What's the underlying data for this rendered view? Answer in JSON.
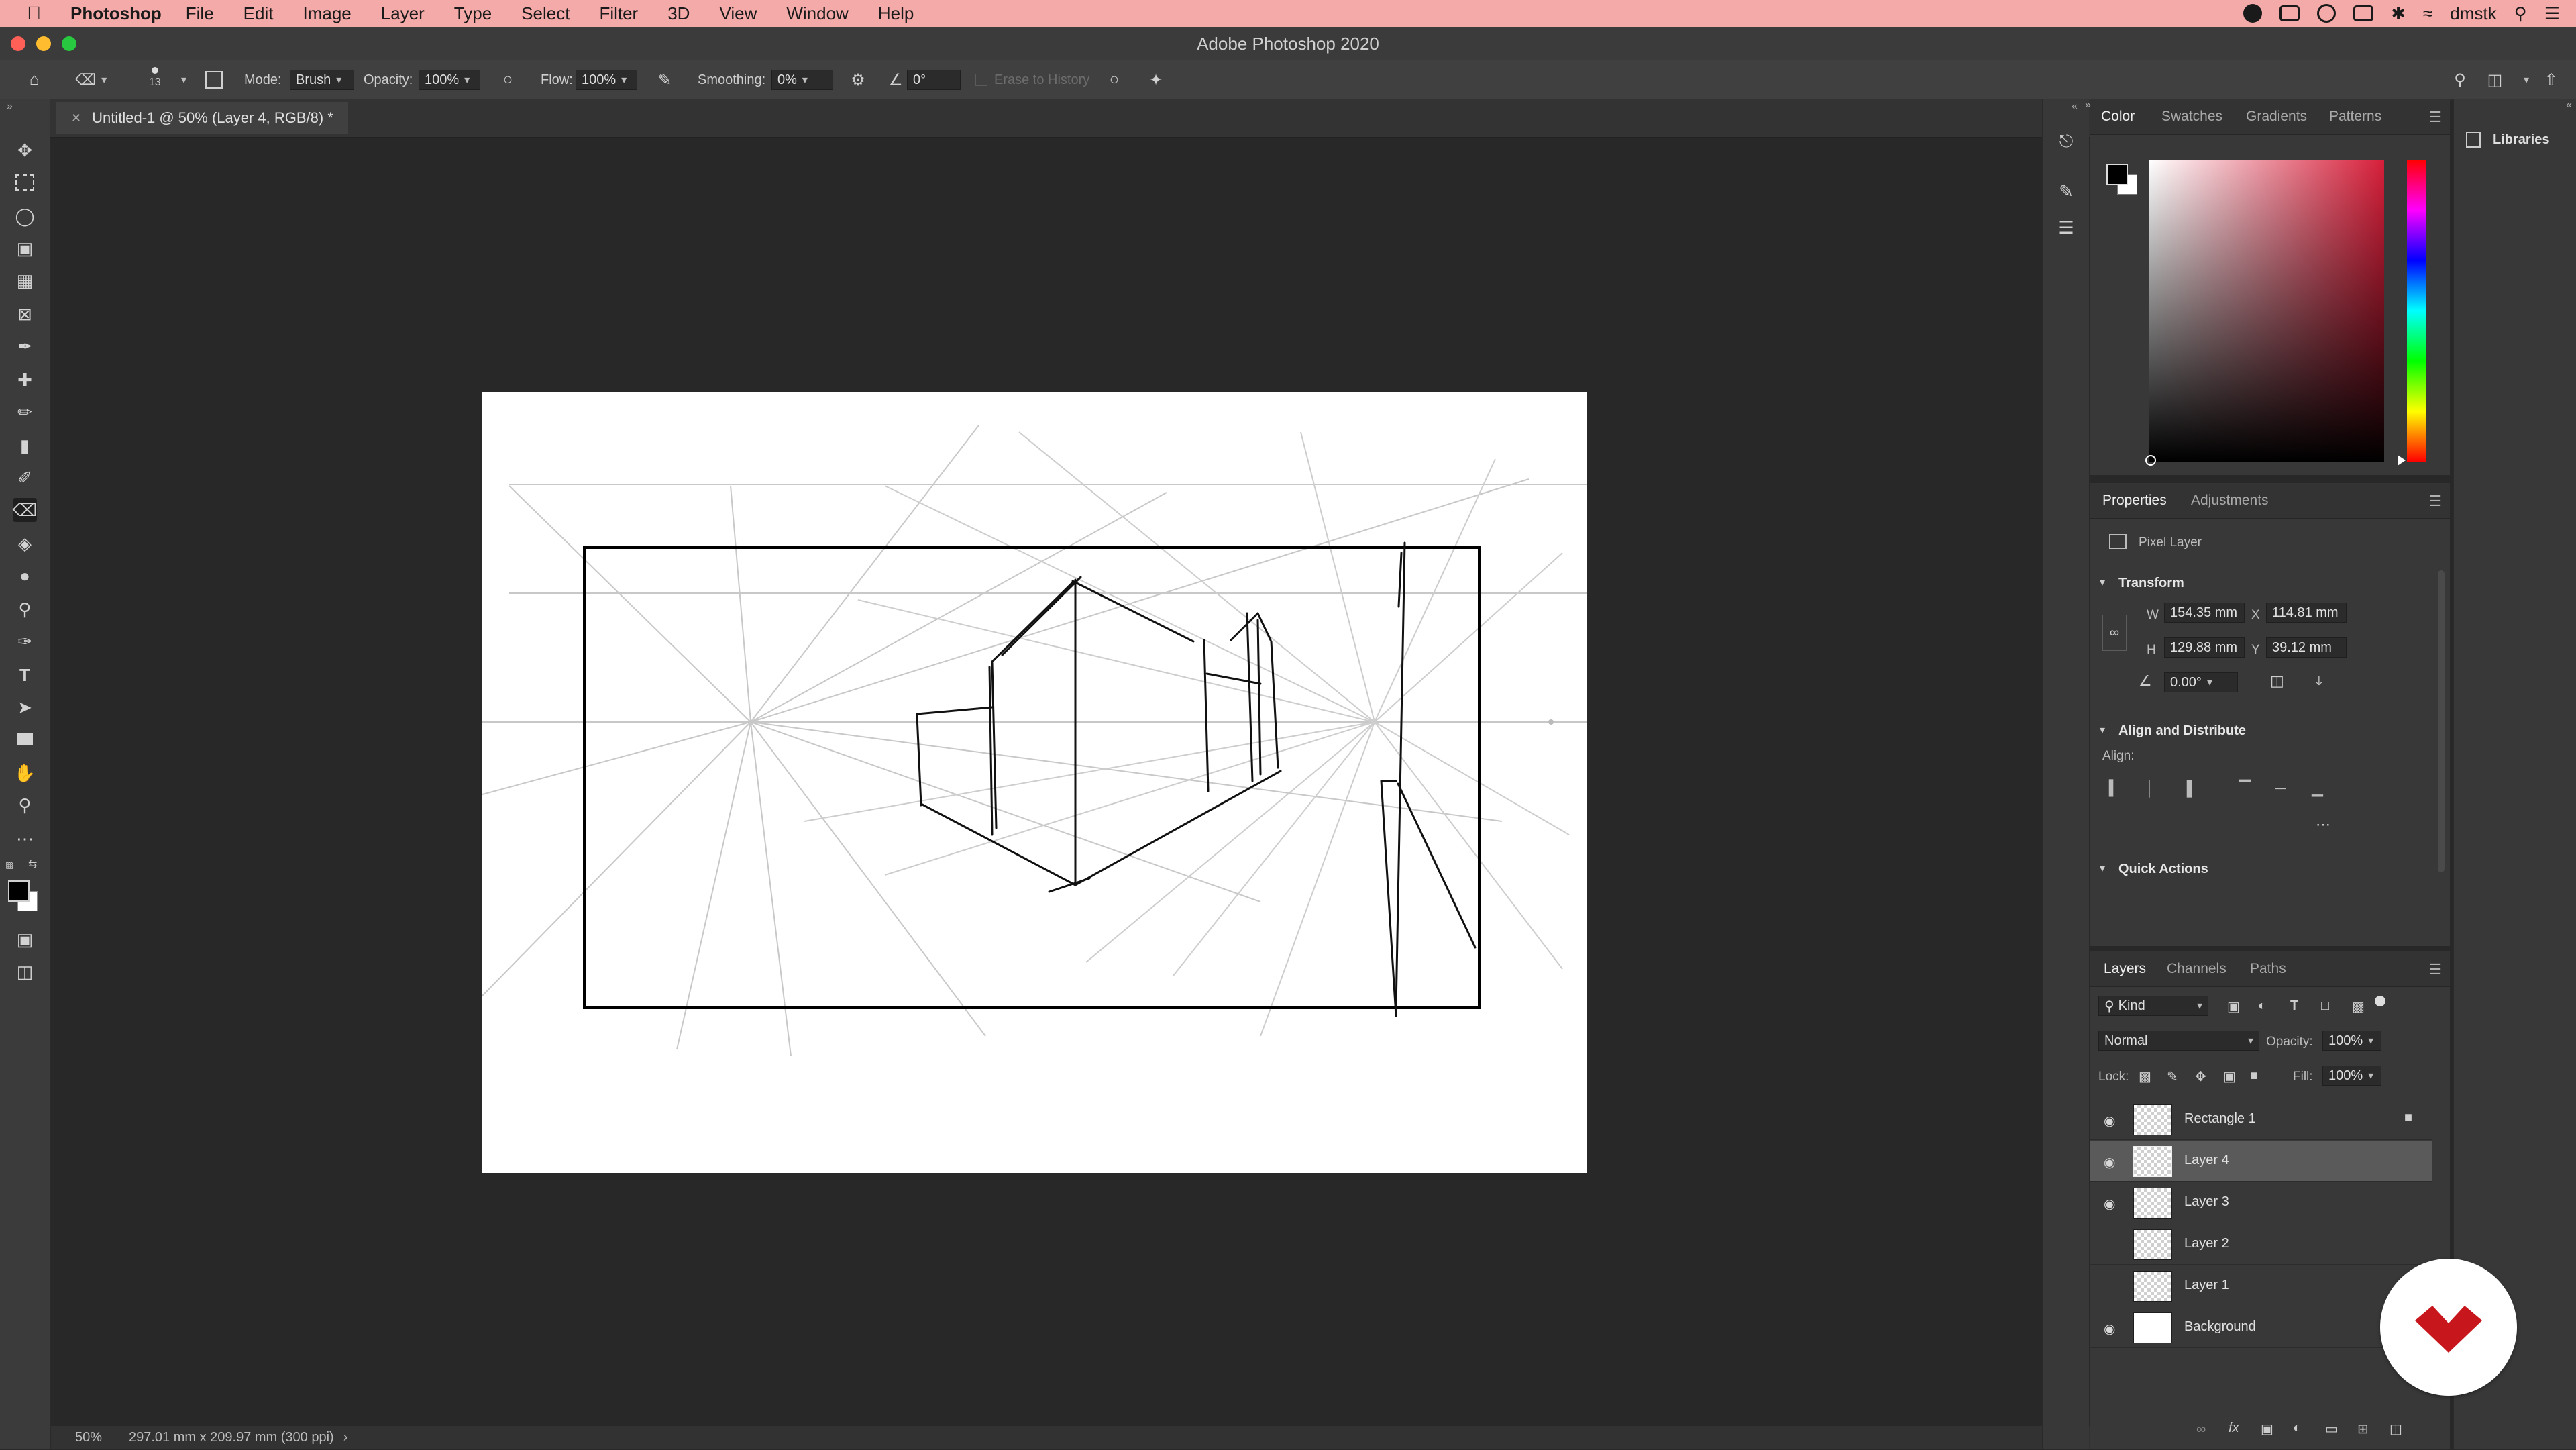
{
  "menubar": {
    "app": "Photoshop",
    "items": [
      "File",
      "Edit",
      "Image",
      "Layer",
      "Type",
      "Select",
      "Filter",
      "3D",
      "View",
      "Window",
      "Help"
    ],
    "user": "dmstk"
  },
  "window": {
    "title": "Adobe Photoshop 2020"
  },
  "options": {
    "brush_size": "13",
    "mode_label": "Mode:",
    "mode_value": "Brush",
    "opacity_label": "Opacity:",
    "opacity_value": "100%",
    "flow_label": "Flow:",
    "flow_value": "100%",
    "smoothing_label": "Smoothing:",
    "smoothing_value": "0%",
    "angle_value": "0°",
    "erase_history": "Erase to History"
  },
  "document": {
    "tab_label": "Untitled-1 @ 50% (Layer 4, RGB/8) *"
  },
  "status": {
    "zoom": "50%",
    "info": "297.01 mm x 209.97 mm (300 ppi)"
  },
  "color_panel": {
    "tabs": [
      "Color",
      "Swatches",
      "Gradients",
      "Patterns"
    ],
    "fg": "#000000",
    "bg": "#ffffff",
    "hue": "#d71f3a"
  },
  "properties_panel": {
    "tabs": [
      "Properties",
      "Adjustments"
    ],
    "layer_type": "Pixel Layer",
    "transform_header": "Transform",
    "w_label": "W",
    "w_value": "154.35 mm",
    "x_label": "X",
    "x_value": "114.81 mm",
    "h_label": "H",
    "h_value": "129.88 mm",
    "y_label": "Y",
    "y_value": "39.12 mm",
    "angle_value": "0.00°",
    "align_header": "Align and Distribute",
    "align_label": "Align:",
    "quick_header": "Quick Actions"
  },
  "layers_panel": {
    "tabs": [
      "Layers",
      "Channels",
      "Paths"
    ],
    "filter_kind": "Kind",
    "blend_mode": "Normal",
    "opacity_label": "Opacity:",
    "opacity_value": "100%",
    "lock_label": "Lock:",
    "fill_label": "Fill:",
    "fill_value": "100%",
    "layers": [
      {
        "name": "Rectangle 1",
        "visible": true,
        "locked": true
      },
      {
        "name": "Layer 4",
        "visible": true,
        "selected": true
      },
      {
        "name": "Layer 3",
        "visible": true
      },
      {
        "name": "Layer 2",
        "visible": false
      },
      {
        "name": "Layer 1",
        "visible": false
      },
      {
        "name": "Background",
        "visible": true
      }
    ]
  },
  "libraries": {
    "label": "Libraries"
  }
}
